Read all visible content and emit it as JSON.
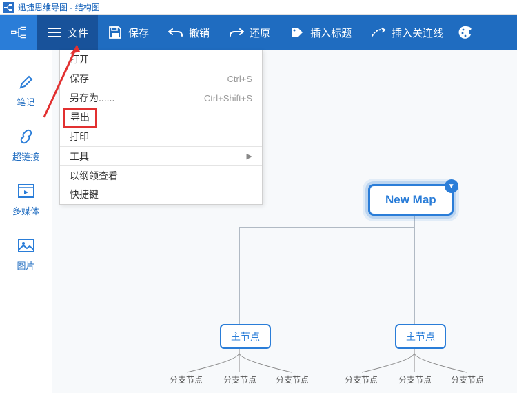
{
  "titlebar": {
    "app_name": "迅捷思维导图",
    "separator": " - ",
    "doc_name": "结构图"
  },
  "toolbar": {
    "file": "文件",
    "save": "保存",
    "undo": "撤销",
    "redo": "还原",
    "insert_title": "插入标题",
    "insert_link": "插入关连线"
  },
  "sidebar": {
    "note": "笔记",
    "hyperlink": "超链接",
    "media": "多媒体",
    "image": "图片"
  },
  "menu": {
    "open": "打开",
    "save": "保存",
    "save_shortcut": "Ctrl+S",
    "save_as": "另存为......",
    "save_as_shortcut": "Ctrl+Shift+S",
    "export": "导出",
    "print": "打印",
    "tools": "工具",
    "outline": "以纲领查看",
    "shortcuts": "快捷键"
  },
  "map": {
    "root": "New Map",
    "main_node": "主节点",
    "leaf": "分支节点"
  },
  "colors": {
    "toolbar_bg": "#1f6cc0",
    "active_bg": "#18529a",
    "accent": "#2a7dd8",
    "highlight": "#e23030"
  }
}
